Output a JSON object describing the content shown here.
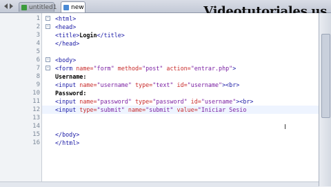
{
  "watermark": "Videotutoriales.us",
  "tabs": [
    {
      "label": "untitled1"
    },
    {
      "label": "new 2"
    }
  ],
  "editor": {
    "lines": [
      {
        "num": "1",
        "html": ""
      },
      {
        "num": "2",
        "html": ""
      },
      {
        "num": "3",
        "html": ""
      },
      {
        "num": "4",
        "html": ""
      },
      {
        "num": "5",
        "html": ""
      },
      {
        "num": "6",
        "html": ""
      },
      {
        "num": "7",
        "html": ""
      },
      {
        "num": "8",
        "html": ""
      },
      {
        "num": "9",
        "html": ""
      },
      {
        "num": "10",
        "html": ""
      },
      {
        "num": "11",
        "html": ""
      },
      {
        "num": "12",
        "html": ""
      },
      {
        "num": "13",
        "html": ""
      },
      {
        "num": "14",
        "html": ""
      },
      {
        "num": "15",
        "html": ""
      },
      {
        "num": "16",
        "html": ""
      }
    ],
    "code": [
      [
        [
          "t",
          "<html>"
        ]
      ],
      [
        [
          "t",
          "<head>"
        ]
      ],
      [
        [
          "t",
          "<title>"
        ],
        [
          "x",
          "Login"
        ],
        [
          "t",
          "</title>"
        ]
      ],
      [
        [
          "t",
          "</head>"
        ]
      ],
      [],
      [
        [
          "t",
          "<body>"
        ]
      ],
      [
        [
          "t",
          "<form "
        ],
        [
          "a",
          "name="
        ],
        [
          "v",
          "\"form\""
        ],
        [
          "p",
          " "
        ],
        [
          "a",
          "method="
        ],
        [
          "v",
          "\"post\""
        ],
        [
          "p",
          " "
        ],
        [
          "a",
          "action="
        ],
        [
          "v",
          "\"entrar.php\""
        ],
        [
          "t",
          ">"
        ]
      ],
      [
        [
          "x",
          "Username:"
        ]
      ],
      [
        [
          "t",
          "<input "
        ],
        [
          "a",
          "name="
        ],
        [
          "v",
          "\"username\""
        ],
        [
          "p",
          " "
        ],
        [
          "a",
          "type="
        ],
        [
          "v",
          "\"text\""
        ],
        [
          "p",
          " "
        ],
        [
          "a",
          "id="
        ],
        [
          "v",
          "\"username\""
        ],
        [
          "t",
          "><br>"
        ]
      ],
      [
        [
          "x",
          "Password:"
        ]
      ],
      [
        [
          "t",
          "<input "
        ],
        [
          "a",
          "name="
        ],
        [
          "v",
          "\"password\""
        ],
        [
          "p",
          " "
        ],
        [
          "a",
          "type="
        ],
        [
          "v",
          "\"password\""
        ],
        [
          "p",
          " "
        ],
        [
          "a",
          "id="
        ],
        [
          "v",
          "\"username\""
        ],
        [
          "t",
          "><br>"
        ]
      ],
      [
        [
          "t",
          "<input "
        ],
        [
          "a",
          "type="
        ],
        [
          "v",
          "\"submit\""
        ],
        [
          "p",
          " "
        ],
        [
          "a",
          "name="
        ],
        [
          "v",
          "\"submit\""
        ],
        [
          "p",
          " "
        ],
        [
          "a",
          "value="
        ],
        [
          "v",
          "\"Iniciar Sesio"
        ]
      ],
      [],
      [],
      [
        [
          "t",
          "</body>"
        ]
      ],
      [
        [
          "t",
          "</html>"
        ]
      ]
    ],
    "indent": [
      1,
      1,
      2,
      1,
      0,
      1,
      2,
      2,
      2,
      2,
      2,
      2,
      0,
      0,
      1,
      1
    ],
    "folds": [
      {
        "line": 1,
        "sym": "-"
      },
      {
        "line": 2,
        "sym": "-"
      },
      {
        "line": 6,
        "sym": "-"
      },
      {
        "line": 7,
        "sym": "-"
      }
    ],
    "current_line": 12
  }
}
